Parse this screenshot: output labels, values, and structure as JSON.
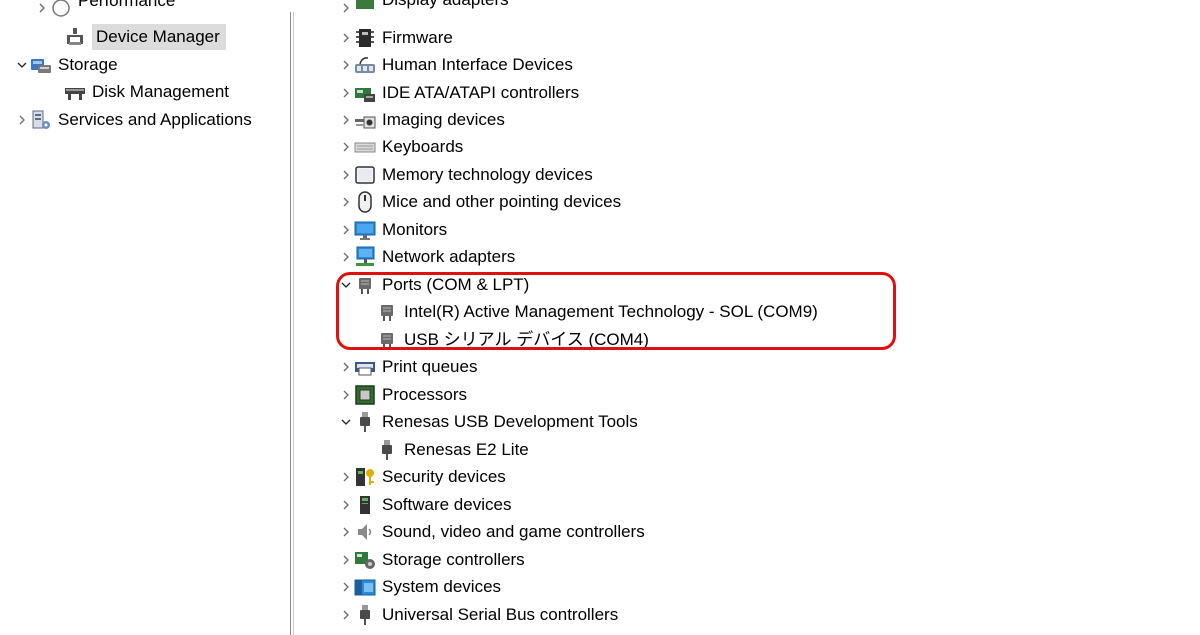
{
  "left_tree": {
    "performance_label": "Performance",
    "device_manager_label": "Device Manager",
    "storage_label": "Storage",
    "disk_management_label": "Disk Management",
    "services_label": "Services and Applications"
  },
  "device_tree": {
    "display_adapters": "Display adapters",
    "firmware": "Firmware",
    "human_interface": "Human Interface Devices",
    "ide_ata": "IDE ATA/ATAPI controllers",
    "imaging": "Imaging devices",
    "keyboards": "Keyboards",
    "memory_tech": "Memory technology devices",
    "mice": "Mice and other pointing devices",
    "monitors": "Monitors",
    "network": "Network adapters",
    "ports": "Ports (COM & LPT)",
    "port_intel": "Intel(R) Active Management Technology - SOL (COM9)",
    "port_usb": "USB シリアル デバイス (COM4)",
    "print_queues": "Print queues",
    "processors": "Processors",
    "renesas_tools": "Renesas USB Development Tools",
    "renesas_e2": "Renesas E2 Lite",
    "security": "Security devices",
    "software": "Software devices",
    "sound": "Sound, video and game controllers",
    "storage_ctrl": "Storage controllers",
    "system": "System devices",
    "usb_ctrl": "Universal Serial Bus controllers"
  },
  "colors": {
    "highlight": "#e01010",
    "selection": "#dcdcdc",
    "chevron": "#6a6a6a"
  },
  "icons": {
    "expanded": "chevron-down-icon",
    "collapsed": "chevron-right-icon"
  }
}
